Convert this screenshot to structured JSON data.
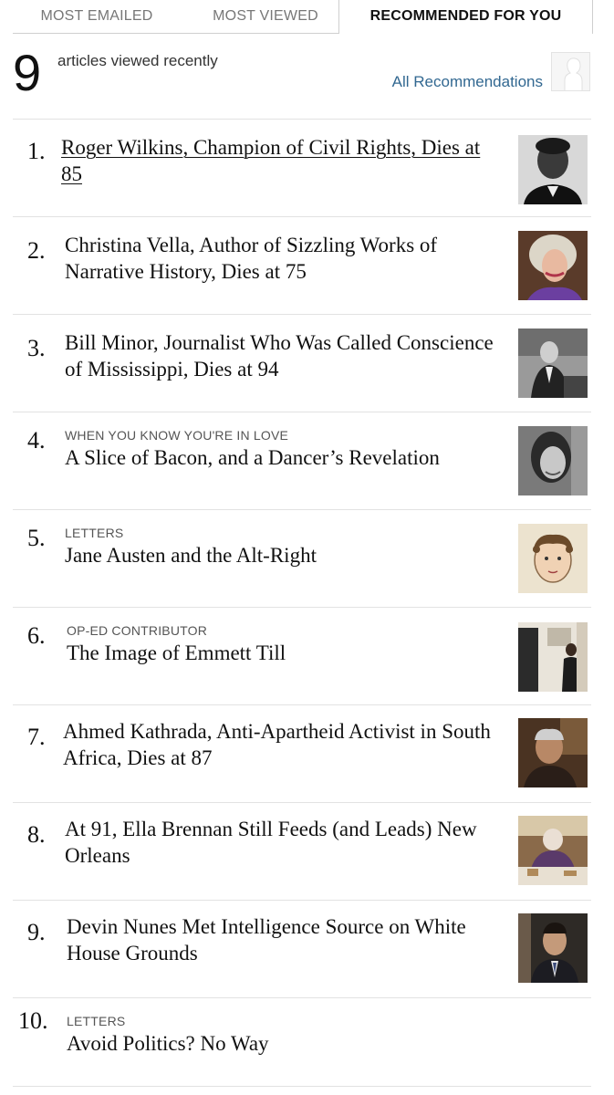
{
  "tabs": [
    {
      "label": "MOST EMAILED"
    },
    {
      "label": "MOST VIEWED"
    },
    {
      "label": "RECOMMENDED FOR YOU"
    }
  ],
  "summary": {
    "count": "9",
    "label": "articles viewed recently",
    "link": "All Recommendations"
  },
  "articles": [
    {
      "number": "1.",
      "kicker": "",
      "headline": "Roger Wilkins, Champion of Civil Rights, Dies at 85"
    },
    {
      "number": "2.",
      "kicker": "",
      "headline": "Christina Vella, Author of Sizzling Works of Narrative History, Dies at 75"
    },
    {
      "number": "3.",
      "kicker": "",
      "headline": "Bill Minor, Journalist Who Was Called Conscience of Mississippi, Dies at 94"
    },
    {
      "number": "4.",
      "kicker": "WHEN YOU KNOW YOU'RE IN LOVE",
      "headline": "A Slice of Bacon, and a Dancer’s Revelation"
    },
    {
      "number": "5.",
      "kicker": "LETTERS",
      "headline": "Jane Austen and the Alt-Right"
    },
    {
      "number": "6.",
      "kicker": "OP-ED CONTRIBUTOR",
      "headline": "The Image of Emmett Till"
    },
    {
      "number": "7.",
      "kicker": "",
      "headline": "Ahmed Kathrada, Anti-Apartheid Activist in South Africa, Dies at 87"
    },
    {
      "number": "8.",
      "kicker": "",
      "headline": "At 91, Ella Brennan Still Feeds (and Leads) New Orleans"
    },
    {
      "number": "9.",
      "kicker": "",
      "headline": "Devin Nunes Met Intelligence Source on White House Grounds"
    },
    {
      "number": "10.",
      "kicker": "LETTERS",
      "headline": "Avoid Politics? No Way"
    }
  ],
  "colors": {
    "link": "#326891",
    "rule": "#e2e2e2",
    "tab_inactive": "#777777"
  }
}
